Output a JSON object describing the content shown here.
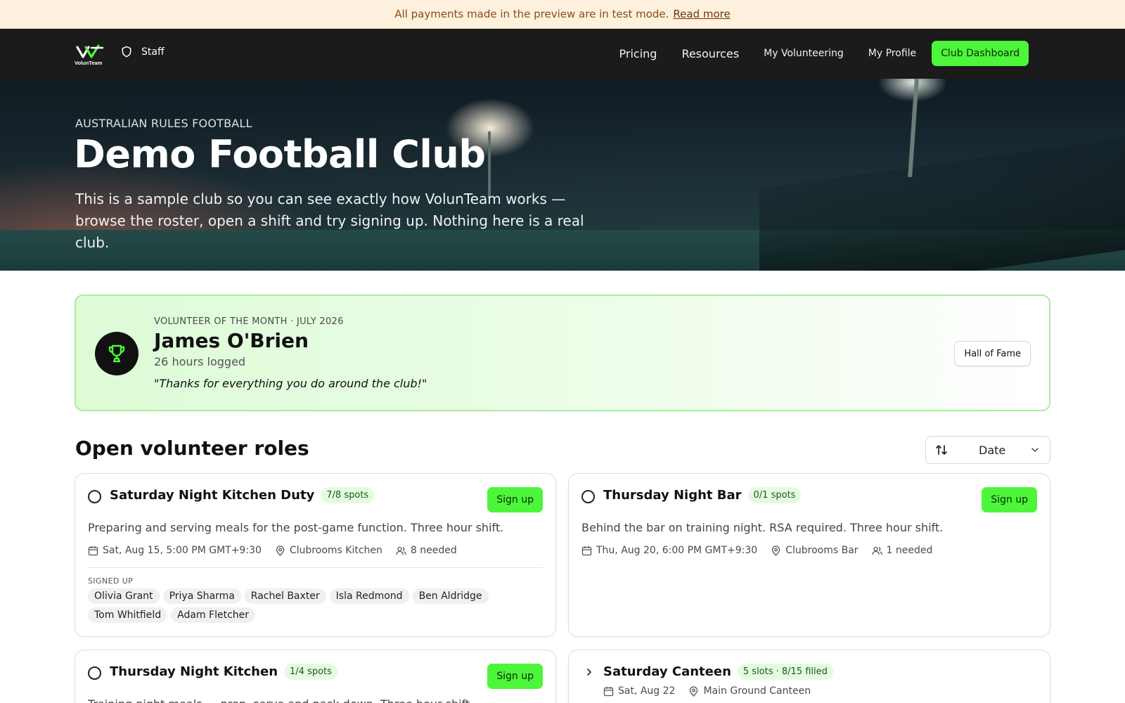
{
  "banner": {
    "text": "All payments made in the preview are in test mode.",
    "link": "Read more"
  },
  "nav": {
    "logo_text": "VolunTeam",
    "staff_label": "Staff",
    "links": [
      "Pricing",
      "Resources",
      "My Volunteering",
      "My Profile"
    ],
    "dashboard_button": "Club Dashboard"
  },
  "hero": {
    "eyebrow": "AUSTRALIAN RULES FOOTBALL",
    "title": "Demo Football Club",
    "description": "This is a sample club so you can see exactly how VolunTeam works — browse the roster, open a shift and try signing up. Nothing here is a real club."
  },
  "volunteer_of_month": {
    "eyebrow": "VOLUNTEER OF THE MONTH · JULY 2026",
    "name": "James O'Brien",
    "hours": "26 hours logged",
    "quote": "\"Thanks for everything you do around the club!\"",
    "hall_of_fame_button": "Hall of Fame"
  },
  "roles": {
    "title": "Open volunteer roles",
    "sort_value": "Date",
    "signup_label": "Sign up",
    "signed_up_label": "SIGNED UP",
    "cards": [
      {
        "title": "Saturday Night Kitchen Duty",
        "spots": "7/8 spots",
        "description": "Preparing and serving meals for the post-game function. Three hour shift.",
        "date": "Sat, Aug 15, 5:00 PM GMT+9:30",
        "location": "Clubrooms Kitchen",
        "needed": "8 needed",
        "signed_up": [
          "Olivia Grant",
          "Priya Sharma",
          "Rachel Baxter",
          "Isla Redmond",
          "Ben Aldridge",
          "Tom Whitfield",
          "Adam Fletcher"
        ]
      },
      {
        "title": "Thursday Night Bar",
        "spots": "0/1 spots",
        "description": "Behind the bar on training night. RSA required. Three hour shift.",
        "date": "Thu, Aug 20, 6:00 PM GMT+9:30",
        "location": "Clubrooms Bar",
        "needed": "1 needed"
      },
      {
        "title": "Thursday Night Kitchen",
        "spots": "1/4 spots",
        "description": "Training night meals — prep, serve and pack down. Three hour shift."
      },
      {
        "title": "Saturday Canteen",
        "spots": "5 slots · 8/15 filled",
        "date": "Sat, Aug 22",
        "location": "Main Ground Canteen"
      }
    ]
  },
  "colors": {
    "accent": "#4df53b",
    "nav_bg": "#1b1b1b",
    "banner_bg": "#fdf0dc",
    "pill_bg": "#e4fbe0"
  }
}
